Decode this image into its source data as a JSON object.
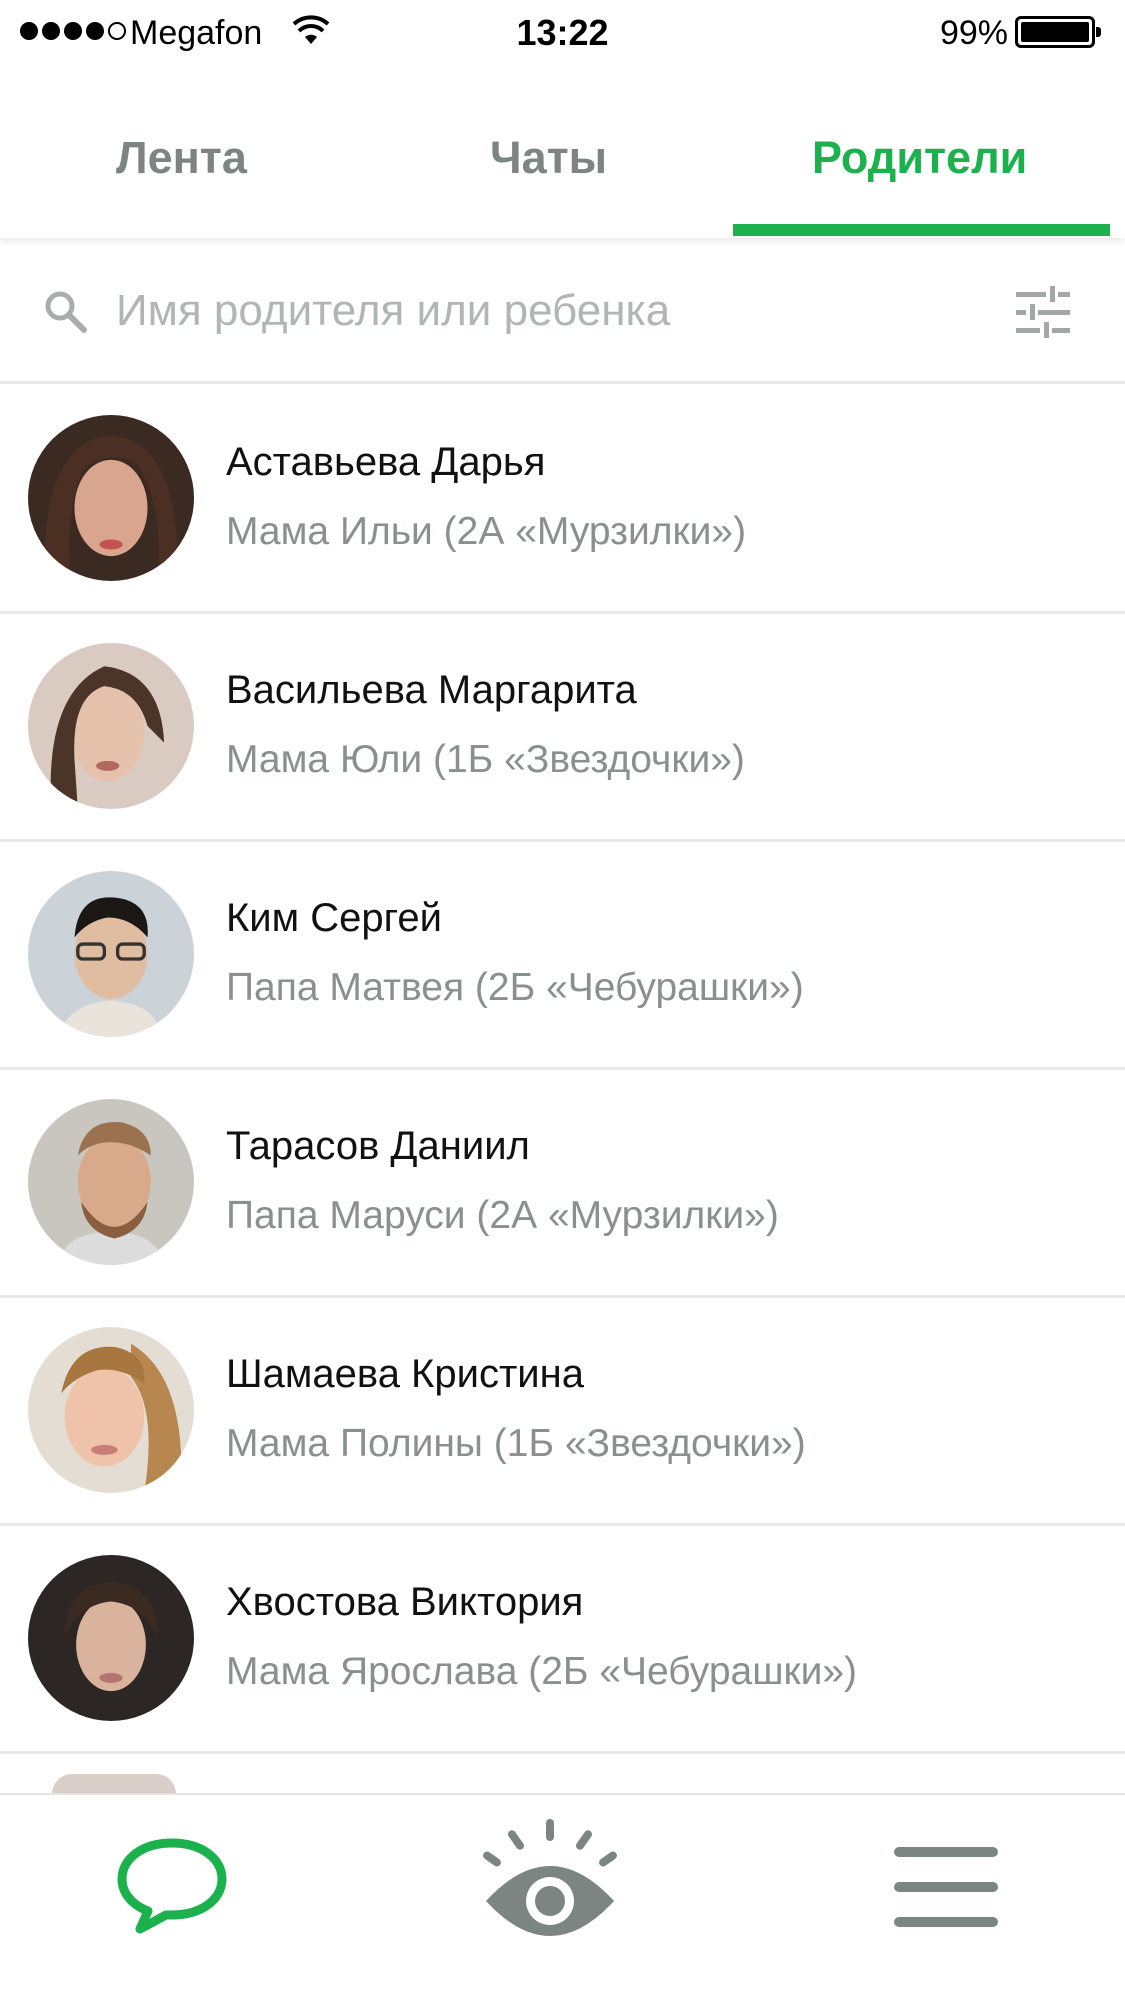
{
  "status_bar": {
    "carrier": "Megafon",
    "time": "13:22",
    "battery": "99%"
  },
  "tabs": [
    {
      "label": "Лента",
      "active": false
    },
    {
      "label": "Чаты",
      "active": false
    },
    {
      "label": "Родители",
      "active": true
    }
  ],
  "search": {
    "placeholder": "Имя родителя или ребенка",
    "value": ""
  },
  "parents": [
    {
      "name": "Аставьева Дарья",
      "role": "Мама Ильи (2А «Мурзилки»)"
    },
    {
      "name": "Васильева Маргарита",
      "role": "Мама Юли (1Б «Звездочки»)"
    },
    {
      "name": "Ким Сергей",
      "role": "Папа Матвея (2Б «Чебурашки»)"
    },
    {
      "name": "Тарасов Даниил",
      "role": "Папа Маруси (2А «Мурзилки»)"
    },
    {
      "name": "Шамаева Кристина",
      "role": "Мама Полины (1Б «Звездочки»)"
    },
    {
      "name": "Хвостова Виктория",
      "role": "Мама Ярослава (2Б «Чебурашки»)"
    }
  ],
  "bottom_nav": [
    {
      "icon": "chat-bubble-icon",
      "active": true
    },
    {
      "icon": "eye-icon",
      "active": false
    },
    {
      "icon": "menu-icon",
      "active": false
    }
  ],
  "colors": {
    "accent": "#1bb14c",
    "inactive": "#7d8583",
    "secondary_text": "#8a908e",
    "placeholder": "#b1b6b4"
  }
}
